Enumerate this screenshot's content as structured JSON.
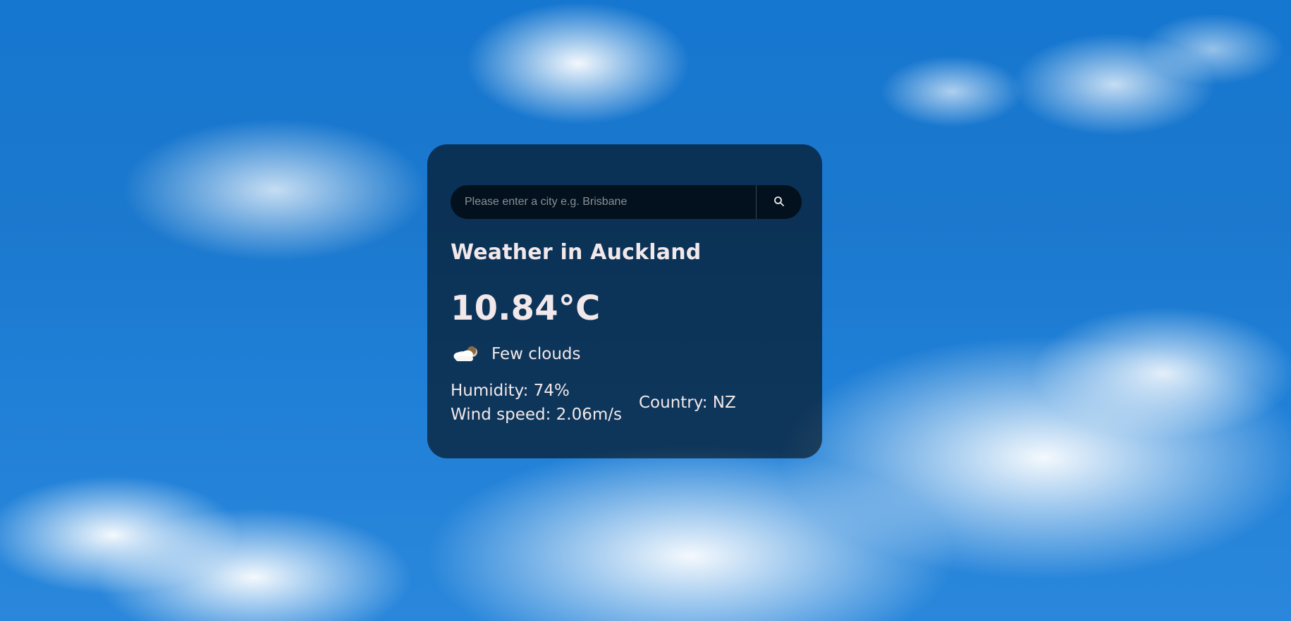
{
  "search": {
    "placeholder": "Please enter a city e.g. Brisbane",
    "value": ""
  },
  "weather": {
    "title": "Weather in Auckland",
    "temperature": "10.84°C",
    "condition": "Few clouds",
    "humidity": "Humidity: 74%",
    "wind_speed": "Wind speed: 2.06m/s",
    "country": "Country: NZ"
  },
  "icons": {
    "search": "search-icon",
    "condition": "few-clouds-icon"
  },
  "colors": {
    "card_background": "#000000",
    "text": "#f2e8ea",
    "sky_blue": "#1b78cd",
    "cloud_white": "#ffffff"
  }
}
